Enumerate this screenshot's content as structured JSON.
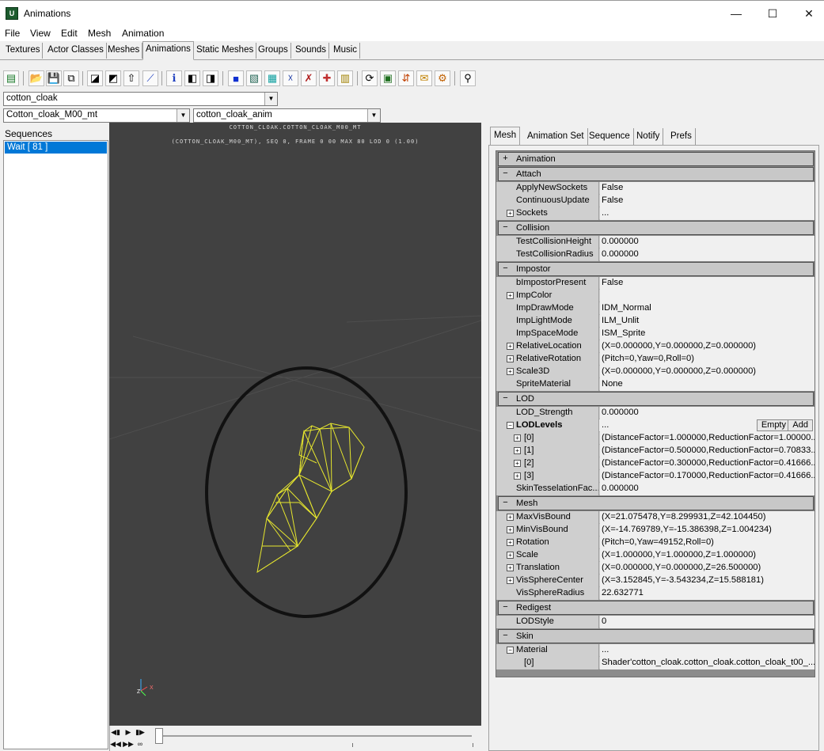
{
  "window": {
    "title": "Animations",
    "icon": "app-logo-icon",
    "minimize": "—",
    "maximize": "☐",
    "close": "✕"
  },
  "menu": [
    "File",
    "View",
    "Edit",
    "Mesh",
    "Animation"
  ],
  "tabs": [
    "Textures",
    "Actor Classes",
    "Meshes",
    "Animations",
    "Static Meshes",
    "Groups",
    "Sounds",
    "Music"
  ],
  "active_tab": "Animations",
  "toolbar_icons": [
    "new-package-icon",
    "open-icon",
    "save-icon",
    "copy-icon",
    "import-mesh-icon",
    "import-anim-icon",
    "import-icon",
    "link-icon",
    "info-icon",
    "mesh-props-icon",
    "anim-props-icon",
    "cube-icon",
    "wireframe-icon",
    "grid-icon",
    "skeleton-icon",
    "bones-icon",
    "socket-icon",
    "bounds-icon",
    "refresh-icon",
    "lod-icon",
    "compress-icon",
    "notify-icon",
    "prefs-icon",
    "pin-icon"
  ],
  "selectors": {
    "package": "cotton_cloak",
    "mesh": "Cotton_cloak_M00_mt",
    "animset": "cotton_cloak_anim"
  },
  "sequences": {
    "label": "Sequences",
    "items": [
      "Wait [ 81 ]"
    ]
  },
  "viewport": {
    "line1": "COTTON_CLOAK.COTTON_CLOAK_M00_MT",
    "line2": "(COTTON_CLOAK_M00_MT), SEQ 0,  FRAME  0 00 MAX 80  LOD 0 (1.00)",
    "axis_z": "Z",
    "axis_x": "X"
  },
  "panel_tabs": [
    "Mesh",
    "Animation Set",
    "Sequence",
    "Notify",
    "Prefs"
  ],
  "active_panel_tab": "Mesh",
  "lod_buttons": {
    "empty": "Empty",
    "add": "Add"
  },
  "properties": [
    {
      "kind": "cat",
      "label": "Animation",
      "exp": "+"
    },
    {
      "kind": "cat",
      "label": "Attach",
      "exp": "−"
    },
    {
      "kind": "prop",
      "name": "ApplyNewSockets",
      "value": "False"
    },
    {
      "kind": "prop",
      "name": "ContinuousUpdate",
      "value": "False"
    },
    {
      "kind": "prop",
      "name": "Sockets",
      "value": "...",
      "exp": "+"
    },
    {
      "kind": "cat",
      "label": "Collision",
      "exp": "−"
    },
    {
      "kind": "prop",
      "name": "TestCollisionHeight",
      "value": "0.000000"
    },
    {
      "kind": "prop",
      "name": "TestCollisionRadius",
      "value": "0.000000"
    },
    {
      "kind": "cat",
      "label": "Impostor",
      "exp": "−"
    },
    {
      "kind": "prop",
      "name": "bImpostorPresent",
      "value": "False"
    },
    {
      "kind": "prop",
      "name": "ImpColor",
      "value": "",
      "exp": "+",
      "color": "#000000"
    },
    {
      "kind": "prop",
      "name": "ImpDrawMode",
      "value": "IDM_Normal"
    },
    {
      "kind": "prop",
      "name": "ImpLightMode",
      "value": "ILM_Unlit"
    },
    {
      "kind": "prop",
      "name": "ImpSpaceMode",
      "value": "ISM_Sprite"
    },
    {
      "kind": "prop",
      "name": "RelativeLocation",
      "value": "(X=0.000000,Y=0.000000,Z=0.000000)",
      "exp": "+"
    },
    {
      "kind": "prop",
      "name": "RelativeRotation",
      "value": "(Pitch=0,Yaw=0,Roll=0)",
      "exp": "+"
    },
    {
      "kind": "prop",
      "name": "Scale3D",
      "value": "(X=0.000000,Y=0.000000,Z=0.000000)",
      "exp": "+"
    },
    {
      "kind": "prop",
      "name": "SpriteMaterial",
      "value": "None"
    },
    {
      "kind": "cat",
      "label": "LOD",
      "exp": "−"
    },
    {
      "kind": "prop",
      "name": "LOD_Strength",
      "value": "0.000000"
    },
    {
      "kind": "prop",
      "name": "LODLevels",
      "value": "...",
      "exp": "−",
      "bold": true,
      "buttons": true
    },
    {
      "kind": "prop",
      "name": "[0]",
      "value": "(DistanceFactor=1.000000,ReductionFactor=1.00000...",
      "exp": "+",
      "nested": true
    },
    {
      "kind": "prop",
      "name": "[1]",
      "value": "(DistanceFactor=0.500000,ReductionFactor=0.70833...",
      "exp": "+",
      "nested": true
    },
    {
      "kind": "prop",
      "name": "[2]",
      "value": "(DistanceFactor=0.300000,ReductionFactor=0.41666...",
      "exp": "+",
      "nested": true
    },
    {
      "kind": "prop",
      "name": "[3]",
      "value": "(DistanceFactor=0.170000,ReductionFactor=0.41666...",
      "exp": "+",
      "nested": true
    },
    {
      "kind": "prop",
      "name": "SkinTesselationFac...",
      "value": "0.000000"
    },
    {
      "kind": "cat",
      "label": "Mesh",
      "exp": "−"
    },
    {
      "kind": "prop",
      "name": "MaxVisBound",
      "value": "(X=21.075478,Y=8.299931,Z=42.104450)",
      "exp": "+"
    },
    {
      "kind": "prop",
      "name": "MinVisBound",
      "value": "(X=-14.769789,Y=-15.386398,Z=1.004234)",
      "exp": "+"
    },
    {
      "kind": "prop",
      "name": "Rotation",
      "value": "(Pitch=0,Yaw=49152,Roll=0)",
      "exp": "+"
    },
    {
      "kind": "prop",
      "name": "Scale",
      "value": "(X=1.000000,Y=1.000000,Z=1.000000)",
      "exp": "+"
    },
    {
      "kind": "prop",
      "name": "Translation",
      "value": "(X=0.000000,Y=0.000000,Z=26.500000)",
      "exp": "+"
    },
    {
      "kind": "prop",
      "name": "VisSphereCenter",
      "value": "(X=3.152845,Y=-3.543234,Z=15.588181)",
      "exp": "+"
    },
    {
      "kind": "prop",
      "name": "VisSphereRadius",
      "value": "22.632771"
    },
    {
      "kind": "cat",
      "label": "Redigest",
      "exp": "−"
    },
    {
      "kind": "prop",
      "name": "LODStyle",
      "value": "0"
    },
    {
      "kind": "cat",
      "label": "Skin",
      "exp": "−"
    },
    {
      "kind": "prop",
      "name": "Material",
      "value": "...",
      "exp": "−"
    },
    {
      "kind": "prop",
      "name": "[0]",
      "value": "Shader'cotton_cloak.cotton_cloak.cotton_cloak_t00_...",
      "nested": true
    }
  ]
}
